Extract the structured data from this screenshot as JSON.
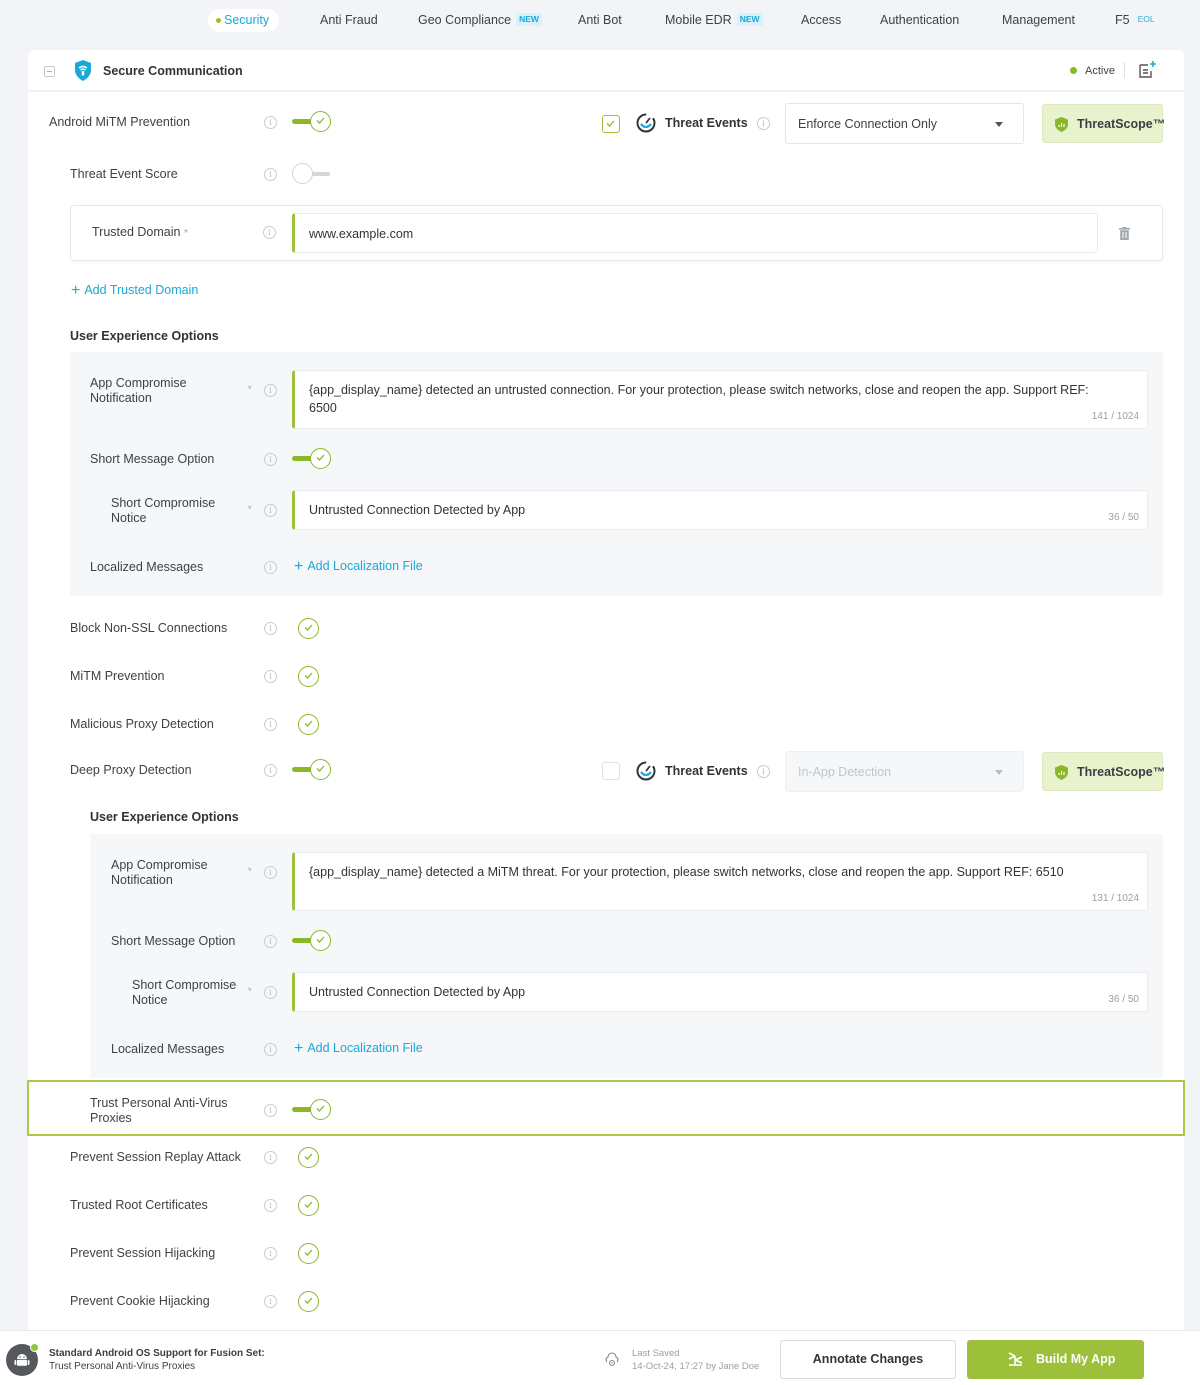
{
  "nav": {
    "tabs": [
      {
        "label": "Security",
        "active": true
      },
      {
        "label": "Anti Fraud"
      },
      {
        "label": "Geo Compliance",
        "badge": "NEW"
      },
      {
        "label": "Anti Bot"
      },
      {
        "label": "Mobile EDR",
        "badge": "NEW"
      },
      {
        "label": "Access"
      },
      {
        "label": "Authentication"
      },
      {
        "label": "Management"
      },
      {
        "label": "F5",
        "badge": "EOL"
      }
    ]
  },
  "panel": {
    "title": "Secure Communication",
    "status": "Active",
    "colors": {
      "accent_green": "#8ab82a",
      "link_blue": "#1aa9d6",
      "threatscope_bg": "#e8f2cd"
    }
  },
  "android_mitm": {
    "label": "Android MiTM Prevention",
    "enabled": true,
    "threat_events_label": "Threat Events",
    "threat_events_checked": true,
    "select_value": "Enforce Connection Only",
    "threatscope_label": "ThreatScope™"
  },
  "threat_event_score": {
    "label": "Threat Event Score",
    "enabled": false
  },
  "trusted_domain": {
    "label": "Trusted Domain",
    "required": "*",
    "value": "www.example.com",
    "add_label": "Add Trusted Domain"
  },
  "ux1": {
    "title": "User Experience Options",
    "app_compromise": {
      "label_line1": "App Compromise",
      "label_line2": "Notification",
      "required": "*",
      "value_line1": "{app_display_name} detected an untrusted connection. For your protection, please switch networks, close and reopen the app. Support REF:",
      "value_line2": "6500",
      "count": "141 / 1024"
    },
    "short_message": {
      "label": "Short Message Option",
      "enabled": true
    },
    "short_notice": {
      "label_line1": "Short Compromise",
      "label_line2": "Notice",
      "required": "*",
      "value": "Untrusted Connection Detected by App",
      "count": "36 / 50"
    },
    "localized": {
      "label": "Localized Messages",
      "add_label": "Add Localization File"
    }
  },
  "checks": [
    {
      "label": "Block Non-SSL Connections",
      "enabled": true
    },
    {
      "label": "MiTM Prevention",
      "enabled": true
    },
    {
      "label": "Malicious Proxy Detection",
      "enabled": true
    }
  ],
  "deep_proxy": {
    "label": "Deep Proxy Detection",
    "enabled": true,
    "threat_events_label": "Threat Events",
    "threat_events_checked": false,
    "select_value": "In-App Detection",
    "threatscope_label": "ThreatScope™"
  },
  "ux2": {
    "title": "User Experience Options",
    "app_compromise": {
      "label_line1": "App Compromise",
      "label_line2": "Notification",
      "required": "*",
      "value_line1": "{app_display_name} detected a MiTM threat. For your protection, please switch networks, close and reopen the app. Support REF: 6510",
      "count": "131 / 1024"
    },
    "short_message": {
      "label": "Short Message Option",
      "enabled": true
    },
    "short_notice": {
      "label_line1": "Short Compromise",
      "label_line2": "Notice",
      "required": "*",
      "value": "Untrusted Connection Detected by App",
      "count": "36 / 50"
    },
    "localized": {
      "label": "Localized Messages",
      "add_label": "Add Localization File"
    }
  },
  "trust_av": {
    "label_line1": "Trust Personal Anti-Virus",
    "label_line2": "Proxies",
    "enabled": true
  },
  "checks2": [
    {
      "label": "Prevent Session Replay Attack",
      "enabled": true
    },
    {
      "label": "Trusted Root Certificates",
      "enabled": true
    },
    {
      "label": "Prevent Session Hijacking",
      "enabled": true
    },
    {
      "label": "Prevent Cookie Hijacking",
      "enabled": true
    }
  ],
  "footer": {
    "title": "Standard Android OS Support for Fusion Set:",
    "subtitle": "Trust Personal Anti-Virus Proxies",
    "last_saved_label": "Last Saved",
    "last_saved_value": "14-Oct-24, 17:27 by Jane Doe",
    "annotate_label": "Annotate Changes",
    "build_label": "Build My App"
  }
}
